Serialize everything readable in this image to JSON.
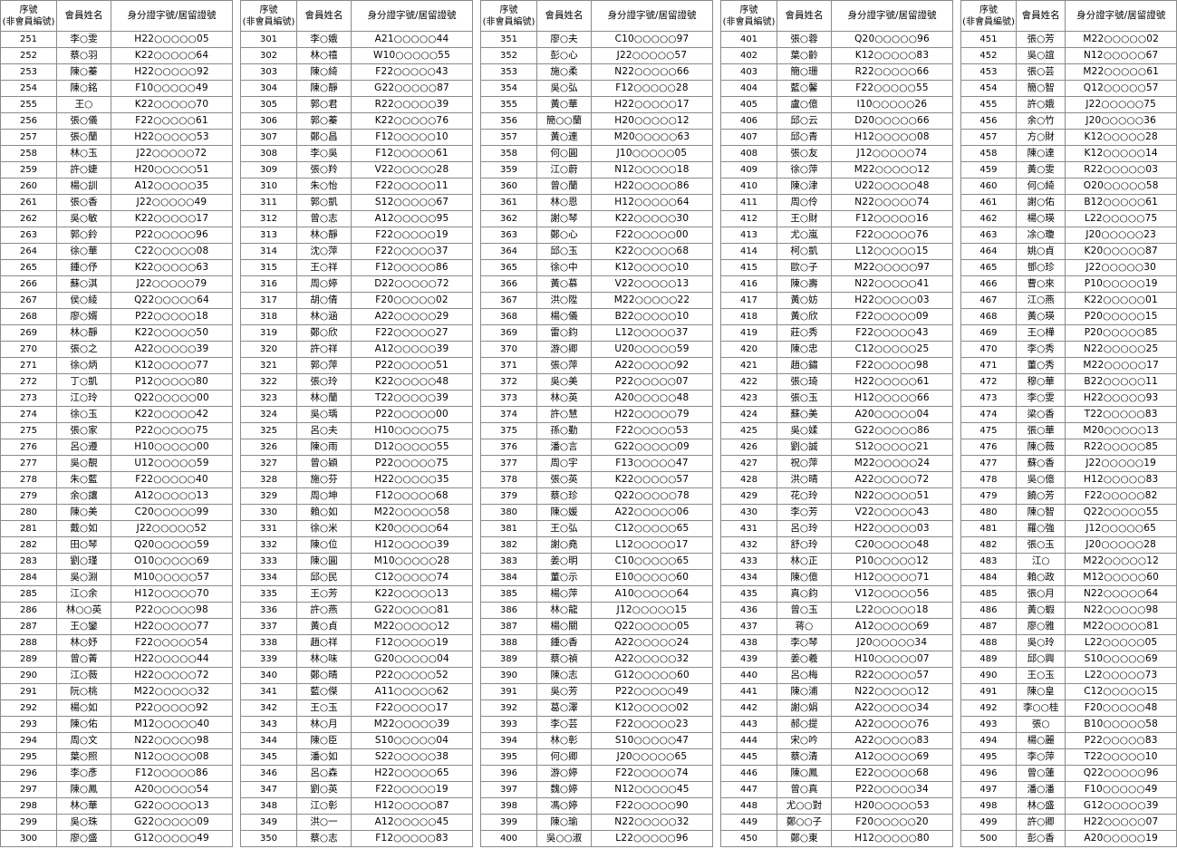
{
  "headers": {
    "seq_line1": "序號",
    "seq_line2": "(非會員編號)",
    "name": "會員姓名",
    "id": "身分證字號/居留證號"
  },
  "blocks": [
    {
      "rows": [
        [
          "251",
          "李○雯",
          "H22○○○○○05"
        ],
        [
          "252",
          "蔡○羽",
          "K22○○○○○64"
        ],
        [
          "253",
          "陳○蓁",
          "H22○○○○○92"
        ],
        [
          "254",
          "陳○銘",
          "F10○○○○○49"
        ],
        [
          "255",
          "王○",
          "K22○○○○○70"
        ],
        [
          "256",
          "張○儀",
          "F22○○○○○61"
        ],
        [
          "257",
          "張○蘭",
          "H22○○○○○53"
        ],
        [
          "258",
          "林○玉",
          "J22○○○○○72"
        ],
        [
          "259",
          "許○婕",
          "H20○○○○○51"
        ],
        [
          "260",
          "楊○訓",
          "A12○○○○○35"
        ],
        [
          "261",
          "張○香",
          "J22○○○○○49"
        ],
        [
          "262",
          "吳○敏",
          "K22○○○○○17"
        ],
        [
          "263",
          "郭○鈴",
          "P22○○○○○96"
        ],
        [
          "264",
          "徐○華",
          "C22○○○○○08"
        ],
        [
          "265",
          "鍾○伃",
          "K22○○○○○63"
        ],
        [
          "266",
          "蘇○淇",
          "J22○○○○○79"
        ],
        [
          "267",
          "侯○綾",
          "Q22○○○○○64"
        ],
        [
          "268",
          "廖○婿",
          "P22○○○○○18"
        ],
        [
          "269",
          "林○靜",
          "K22○○○○○50"
        ],
        [
          "270",
          "張○之",
          "A22○○○○○39"
        ],
        [
          "271",
          "徐○炳",
          "K12○○○○○77"
        ],
        [
          "272",
          "丁○凱",
          "P12○○○○○80"
        ],
        [
          "273",
          "江○玲",
          "Q22○○○○○00"
        ],
        [
          "274",
          "徐○玉",
          "K22○○○○○42"
        ],
        [
          "275",
          "張○家",
          "P22○○○○○75"
        ],
        [
          "276",
          "呂○遵",
          "H10○○○○○00"
        ],
        [
          "277",
          "吳○靚",
          "U12○○○○○59"
        ],
        [
          "278",
          "朱○藍",
          "F22○○○○○40"
        ],
        [
          "279",
          "余○讓",
          "A12○○○○○13"
        ],
        [
          "280",
          "陳○美",
          "C20○○○○○99"
        ],
        [
          "281",
          "戴○如",
          "J22○○○○○52"
        ],
        [
          "282",
          "田○琴",
          "Q20○○○○○59"
        ],
        [
          "283",
          "劉○瑾",
          "O10○○○○○69"
        ],
        [
          "284",
          "吳○淵",
          "M10○○○○○57"
        ],
        [
          "285",
          "江○余",
          "H12○○○○○70"
        ],
        [
          "286",
          "林○○英",
          "P22○○○○○98"
        ],
        [
          "287",
          "王○鑾",
          "H22○○○○○77"
        ],
        [
          "288",
          "林○妤",
          "F22○○○○○54"
        ],
        [
          "289",
          "曾○菁",
          "H22○○○○○44"
        ],
        [
          "290",
          "江○薇",
          "H22○○○○○72"
        ],
        [
          "291",
          "阮○桃",
          "M22○○○○○32"
        ],
        [
          "292",
          "楊○如",
          "P22○○○○○92"
        ],
        [
          "293",
          "陳○佑",
          "M12○○○○○40"
        ],
        [
          "294",
          "周○文",
          "N22○○○○○98"
        ],
        [
          "295",
          "葉○照",
          "N12○○○○○08"
        ],
        [
          "296",
          "李○彥",
          "F12○○○○○86"
        ],
        [
          "297",
          "陳○鳳",
          "A20○○○○○54"
        ],
        [
          "298",
          "林○華",
          "G22○○○○○13"
        ],
        [
          "299",
          "吳○珠",
          "G22○○○○○09"
        ],
        [
          "300",
          "廖○盛",
          "G12○○○○○49"
        ]
      ]
    },
    {
      "rows": [
        [
          "301",
          "李○娥",
          "A21○○○○○44"
        ],
        [
          "302",
          "林○禧",
          "W10○○○○○55"
        ],
        [
          "303",
          "陳○綺",
          "F22○○○○○43"
        ],
        [
          "304",
          "陳○靜",
          "G22○○○○○87"
        ],
        [
          "305",
          "郭○君",
          "R22○○○○○39"
        ],
        [
          "306",
          "郭○蓁",
          "K22○○○○○76"
        ],
        [
          "307",
          "鄭○昌",
          "F12○○○○○10"
        ],
        [
          "308",
          "李○吳",
          "F12○○○○○61"
        ],
        [
          "309",
          "張○羚",
          "V22○○○○○28"
        ],
        [
          "310",
          "朱○怡",
          "F22○○○○○11"
        ],
        [
          "311",
          "郭○凱",
          "S12○○○○○67"
        ],
        [
          "312",
          "曾○志",
          "A12○○○○○95"
        ],
        [
          "313",
          "林○靜",
          "F22○○○○○19"
        ],
        [
          "314",
          "沈○萍",
          "F22○○○○○37"
        ],
        [
          "315",
          "王○祥",
          "F12○○○○○86"
        ],
        [
          "316",
          "周○婷",
          "D22○○○○○72"
        ],
        [
          "317",
          "胡○倩",
          "F20○○○○○02"
        ],
        [
          "318",
          "林○涵",
          "A22○○○○○29"
        ],
        [
          "319",
          "鄭○欣",
          "F22○○○○○27"
        ],
        [
          "320",
          "許○祥",
          "A12○○○○○39"
        ],
        [
          "321",
          "郭○萍",
          "P22○○○○○51"
        ],
        [
          "322",
          "張○玲",
          "K22○○○○○48"
        ],
        [
          "323",
          "林○蘭",
          "T22○○○○○39"
        ],
        [
          "324",
          "吳○瑀",
          "P22○○○○○00"
        ],
        [
          "325",
          "呂○夫",
          "H10○○○○○75"
        ],
        [
          "326",
          "陳○雨",
          "D12○○○○○55"
        ],
        [
          "327",
          "曾○穎",
          "P22○○○○○75"
        ],
        [
          "328",
          "施○芬",
          "H22○○○○○35"
        ],
        [
          "329",
          "周○坤",
          "F12○○○○○68"
        ],
        [
          "330",
          "賴○如",
          "M22○○○○○58"
        ],
        [
          "331",
          "徐○米",
          "K20○○○○○64"
        ],
        [
          "332",
          "陳○位",
          "H12○○○○○39"
        ],
        [
          "333",
          "陳○圓",
          "M10○○○○○28"
        ],
        [
          "334",
          "邱○民",
          "C12○○○○○74"
        ],
        [
          "335",
          "王○芳",
          "K22○○○○○13"
        ],
        [
          "336",
          "許○燕",
          "G22○○○○○81"
        ],
        [
          "337",
          "黃○貞",
          "M22○○○○○12"
        ],
        [
          "338",
          "趙○祥",
          "F12○○○○○19"
        ],
        [
          "339",
          "林○味",
          "G20○○○○○04"
        ],
        [
          "340",
          "鄭○晴",
          "P22○○○○○52"
        ],
        [
          "341",
          "藍○傑",
          "A11○○○○○62"
        ],
        [
          "342",
          "王○玉",
          "F22○○○○○17"
        ],
        [
          "343",
          "林○月",
          "M22○○○○○39"
        ],
        [
          "344",
          "陳○臣",
          "S10○○○○○04"
        ],
        [
          "345",
          "潘○如",
          "S22○○○○○38"
        ],
        [
          "346",
          "呂○森",
          "H22○○○○○65"
        ],
        [
          "347",
          "劉○英",
          "F22○○○○○19"
        ],
        [
          "348",
          "江○彰",
          "H12○○○○○87"
        ],
        [
          "349",
          "洪○一",
          "A12○○○○○45"
        ],
        [
          "350",
          "蔡○志",
          "F12○○○○○83"
        ]
      ]
    },
    {
      "rows": [
        [
          "351",
          "廖○夫",
          "C10○○○○○97"
        ],
        [
          "352",
          "彭○心",
          "J22○○○○○57"
        ],
        [
          "353",
          "施○柔",
          "N22○○○○○66"
        ],
        [
          "354",
          "吳○弘",
          "F12○○○○○28"
        ],
        [
          "355",
          "黃○華",
          "H22○○○○○17"
        ],
        [
          "356",
          "簡○○蘭",
          "H20○○○○○12"
        ],
        [
          "357",
          "黃○連",
          "M20○○○○○63"
        ],
        [
          "358",
          "何○圓",
          "J10○○○○○05"
        ],
        [
          "359",
          "江○蔚",
          "N12○○○○○18"
        ],
        [
          "360",
          "曾○蘭",
          "H22○○○○○86"
        ],
        [
          "361",
          "林○恩",
          "H12○○○○○64"
        ],
        [
          "362",
          "謝○琴",
          "K22○○○○○30"
        ],
        [
          "363",
          "鄭○心",
          "F22○○○○○00"
        ],
        [
          "364",
          "邱○玉",
          "K22○○○○○68"
        ],
        [
          "365",
          "徐○中",
          "K12○○○○○10"
        ],
        [
          "366",
          "黃○慕",
          "V22○○○○○13"
        ],
        [
          "367",
          "洪○陞",
          "M22○○○○○22"
        ],
        [
          "368",
          "楊○儀",
          "B22○○○○○10"
        ],
        [
          "369",
          "雷○鈞",
          "L12○○○○○37"
        ],
        [
          "370",
          "游○卿",
          "U20○○○○○59"
        ],
        [
          "371",
          "張○萍",
          "A22○○○○○92"
        ],
        [
          "372",
          "吳○美",
          "P22○○○○○07"
        ],
        [
          "373",
          "林○英",
          "A20○○○○○48"
        ],
        [
          "374",
          "許○慧",
          "H22○○○○○79"
        ],
        [
          "375",
          "孫○勤",
          "F22○○○○○53"
        ],
        [
          "376",
          "潘○言",
          "G22○○○○○09"
        ],
        [
          "377",
          "周○宇",
          "F13○○○○○47"
        ],
        [
          "378",
          "張○英",
          "K22○○○○○57"
        ],
        [
          "379",
          "蔡○珍",
          "Q22○○○○○78"
        ],
        [
          "380",
          "陳○媛",
          "A22○○○○○06"
        ],
        [
          "381",
          "王○弘",
          "C12○○○○○65"
        ],
        [
          "382",
          "謝○堯",
          "L12○○○○○17"
        ],
        [
          "383",
          "姜○明",
          "C10○○○○○65"
        ],
        [
          "384",
          "董○示",
          "E10○○○○○60"
        ],
        [
          "385",
          "楊○萍",
          "A10○○○○○64"
        ],
        [
          "386",
          "林○龍",
          "J12○○○○○15"
        ],
        [
          "387",
          "楊○關",
          "Q22○○○○○05"
        ],
        [
          "388",
          "鍾○香",
          "A22○○○○○24"
        ],
        [
          "389",
          "蔡○禎",
          "A22○○○○○32"
        ],
        [
          "390",
          "陳○志",
          "G12○○○○○60"
        ],
        [
          "391",
          "吳○芳",
          "P22○○○○○49"
        ],
        [
          "392",
          "葛○澤",
          "K12○○○○○02"
        ],
        [
          "393",
          "李○芸",
          "F22○○○○○23"
        ],
        [
          "394",
          "林○彰",
          "S10○○○○○47"
        ],
        [
          "395",
          "何○卿",
          "J20○○○○○65"
        ],
        [
          "396",
          "游○婷",
          "F22○○○○○74"
        ],
        [
          "397",
          "魏○婷",
          "N12○○○○○45"
        ],
        [
          "398",
          "馮○婷",
          "F22○○○○○90"
        ],
        [
          "399",
          "陳○瑜",
          "N22○○○○○32"
        ],
        [
          "400",
          "吳○○淑",
          "L22○○○○○96"
        ]
      ]
    },
    {
      "rows": [
        [
          "401",
          "張○蓉",
          "Q20○○○○○96"
        ],
        [
          "402",
          "葉○齡",
          "K12○○○○○83"
        ],
        [
          "403",
          "簡○珊",
          "R22○○○○○66"
        ],
        [
          "404",
          "藍○馨",
          "F22○○○○○55"
        ],
        [
          "405",
          "盧○億",
          "I10○○○○○26"
        ],
        [
          "406",
          "邱○云",
          "D20○○○○○66"
        ],
        [
          "407",
          "邱○青",
          "H12○○○○○08"
        ],
        [
          "408",
          "張○友",
          "J12○○○○○74"
        ],
        [
          "409",
          "徐○萍",
          "M22○○○○○12"
        ],
        [
          "410",
          "陳○津",
          "U22○○○○○48"
        ],
        [
          "411",
          "周○伶",
          "N22○○○○○74"
        ],
        [
          "412",
          "王○財",
          "F12○○○○○16"
        ],
        [
          "413",
          "尤○嵐",
          "F22○○○○○76"
        ],
        [
          "414",
          "柯○凱",
          "L12○○○○○15"
        ],
        [
          "415",
          "歐○子",
          "M22○○○○○97"
        ],
        [
          "416",
          "陳○壽",
          "N22○○○○○41"
        ],
        [
          "417",
          "黃○妨",
          "H22○○○○○03"
        ],
        [
          "418",
          "黃○欣",
          "F22○○○○○09"
        ],
        [
          "419",
          "莊○秀",
          "F22○○○○○43"
        ],
        [
          "420",
          "陳○忠",
          "C12○○○○○25"
        ],
        [
          "421",
          "趙○鏽",
          "F22○○○○○98"
        ],
        [
          "422",
          "張○琦",
          "H22○○○○○61"
        ],
        [
          "423",
          "張○玉",
          "H12○○○○○66"
        ],
        [
          "424",
          "蘇○美",
          "A20○○○○○04"
        ],
        [
          "425",
          "吳○媃",
          "G22○○○○○86"
        ],
        [
          "426",
          "劉○誠",
          "S12○○○○○21"
        ],
        [
          "427",
          "祝○萍",
          "M22○○○○○24"
        ],
        [
          "428",
          "洪○晴",
          "A22○○○○○72"
        ],
        [
          "429",
          "花○玲",
          "N22○○○○○51"
        ],
        [
          "430",
          "李○芳",
          "V22○○○○○43"
        ],
        [
          "431",
          "呂○玲",
          "H22○○○○○03"
        ],
        [
          "432",
          "舒○玲",
          "C20○○○○○48"
        ],
        [
          "433",
          "林○正",
          "P10○○○○○12"
        ],
        [
          "434",
          "陳○億",
          "H12○○○○○71"
        ],
        [
          "435",
          "真○鈞",
          "V12○○○○○56"
        ],
        [
          "436",
          "曾○玉",
          "L22○○○○○18"
        ],
        [
          "437",
          "蒋○",
          "A12○○○○○69"
        ],
        [
          "438",
          "李○琴",
          "J20○○○○○34"
        ],
        [
          "439",
          "姜○羲",
          "H10○○○○○07"
        ],
        [
          "440",
          "呂○梅",
          "R22○○○○○57"
        ],
        [
          "441",
          "陳○浦",
          "N22○○○○○12"
        ],
        [
          "442",
          "謝○娟",
          "A22○○○○○34"
        ],
        [
          "443",
          "郝○提",
          "A22○○○○○76"
        ],
        [
          "444",
          "宋○吟",
          "A22○○○○○83"
        ],
        [
          "445",
          "蔡○清",
          "A12○○○○○69"
        ],
        [
          "446",
          "陳○鳳",
          "E22○○○○○68"
        ],
        [
          "447",
          "曾○真",
          "P22○○○○○34"
        ],
        [
          "448",
          "尤○○對",
          "H20○○○○○53"
        ],
        [
          "449",
          "鄭○○子",
          "F20○○○○○20"
        ],
        [
          "450",
          "鄭○東",
          "H12○○○○○80"
        ]
      ]
    },
    {
      "rows": [
        [
          "451",
          "張○芳",
          "M22○○○○○02"
        ],
        [
          "452",
          "吳○誼",
          "N12○○○○○67"
        ],
        [
          "453",
          "張○芸",
          "M22○○○○○61"
        ],
        [
          "454",
          "簡○智",
          "Q12○○○○○57"
        ],
        [
          "455",
          "許○娥",
          "J22○○○○○75"
        ],
        [
          "456",
          "余○竹",
          "J20○○○○○36"
        ],
        [
          "457",
          "方○財",
          "K12○○○○○28"
        ],
        [
          "458",
          "陳○達",
          "K12○○○○○14"
        ],
        [
          "459",
          "黃○雯",
          "R22○○○○○03"
        ],
        [
          "460",
          "何○綺",
          "O20○○○○○58"
        ],
        [
          "461",
          "謝○佑",
          "B12○○○○○61"
        ],
        [
          "462",
          "楊○瑛",
          "L22○○○○○75"
        ],
        [
          "463",
          "凃○瓊",
          "J20○○○○○23"
        ],
        [
          "464",
          "姚○貞",
          "K20○○○○○87"
        ],
        [
          "465",
          "鄧○珍",
          "J22○○○○○30"
        ],
        [
          "466",
          "曹○來",
          "P10○○○○○19"
        ],
        [
          "467",
          "江○燕",
          "K22○○○○○01"
        ],
        [
          "468",
          "黃○瑛",
          "P20○○○○○15"
        ],
        [
          "469",
          "王○樺",
          "P20○○○○○85"
        ],
        [
          "470",
          "李○秀",
          "N22○○○○○25"
        ],
        [
          "471",
          "董○秀",
          "M22○○○○○17"
        ],
        [
          "472",
          "穆○華",
          "B22○○○○○11"
        ],
        [
          "473",
          "李○雯",
          "H22○○○○○93"
        ],
        [
          "474",
          "梁○香",
          "T22○○○○○83"
        ],
        [
          "475",
          "張○華",
          "M20○○○○○13"
        ],
        [
          "476",
          "陳○薇",
          "R22○○○○○85"
        ],
        [
          "477",
          "蘇○香",
          "J22○○○○○19"
        ],
        [
          "478",
          "吳○億",
          "H12○○○○○83"
        ],
        [
          "479",
          "饒○芳",
          "F22○○○○○82"
        ],
        [
          "480",
          "陳○智",
          "Q22○○○○○55"
        ],
        [
          "481",
          "羅○強",
          "J12○○○○○65"
        ],
        [
          "482",
          "張○玉",
          "J20○○○○○28"
        ],
        [
          "483",
          "江○",
          "M22○○○○○12"
        ],
        [
          "484",
          "賴○政",
          "M12○○○○○60"
        ],
        [
          "485",
          "張○月",
          "N22○○○○○64"
        ],
        [
          "486",
          "黃○蝦",
          "N22○○○○○98"
        ],
        [
          "487",
          "廖○雅",
          "M22○○○○○81"
        ],
        [
          "488",
          "吳○玲",
          "L22○○○○○05"
        ],
        [
          "489",
          "邱○興",
          "S10○○○○○69"
        ],
        [
          "490",
          "王○玉",
          "L22○○○○○73"
        ],
        [
          "491",
          "陳○皇",
          "C12○○○○○15"
        ],
        [
          "492",
          "李○○桂",
          "F20○○○○○48"
        ],
        [
          "493",
          "張○",
          "B10○○○○○58"
        ],
        [
          "494",
          "楊○麗",
          "P22○○○○○83"
        ],
        [
          "495",
          "李○萍",
          "T22○○○○○10"
        ],
        [
          "496",
          "曾○蓮",
          "Q22○○○○○96"
        ],
        [
          "497",
          "潘○潘",
          "F10○○○○○49"
        ],
        [
          "498",
          "林○盛",
          "G12○○○○○39"
        ],
        [
          "499",
          "許○卿",
          "H22○○○○○07"
        ],
        [
          "500",
          "彭○香",
          "A20○○○○○19"
        ]
      ]
    }
  ]
}
